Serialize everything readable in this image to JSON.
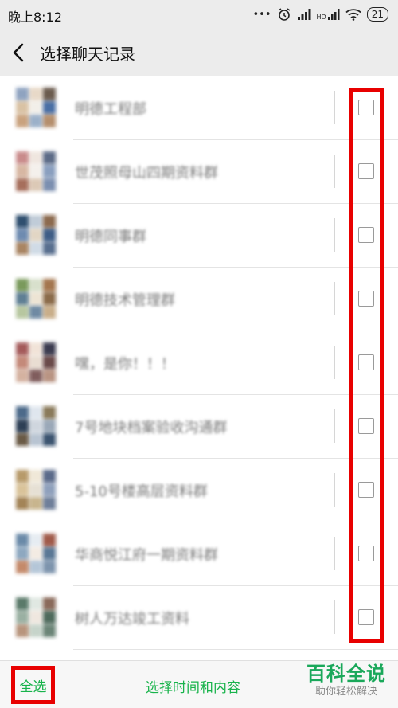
{
  "status_bar": {
    "time": "晚上8:12",
    "signal_label": "HD",
    "battery": "21"
  },
  "header": {
    "title": "选择聊天记录"
  },
  "chats": [
    {
      "name": "明德工程部",
      "checked": false
    },
    {
      "name": "世茂照母山四期资料群",
      "checked": false
    },
    {
      "name": "明德同事群",
      "checked": false
    },
    {
      "name": "明德技术管理群",
      "checked": false
    },
    {
      "name": "嘿，是你！！！",
      "checked": false
    },
    {
      "name": "7号地块档案验收沟通群",
      "checked": false
    },
    {
      "name": "5-10号楼高层资料群",
      "checked": false
    },
    {
      "name": "华商悦江府一期资料群",
      "checked": false
    },
    {
      "name": "树人万达竣工资料",
      "checked": false
    }
  ],
  "footer": {
    "select_all": "全选",
    "select_by_time": "选择时间和内容"
  },
  "watermark": {
    "main": "百科全说",
    "sub": "助你轻松解决"
  },
  "colors": {
    "accent_green": "#18b34b",
    "highlight_red": "#e80000",
    "bar_gray": "#ececec"
  }
}
